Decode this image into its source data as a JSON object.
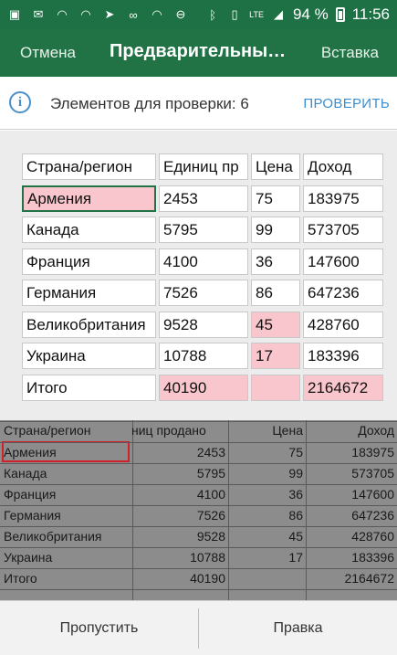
{
  "status": {
    "battery": "94 %",
    "time": "11:56",
    "signal": "LTE"
  },
  "appbar": {
    "cancel": "Отмена",
    "title": "Предварительный...",
    "insert": "Вставка"
  },
  "info": {
    "text": "Элементов для проверки: 6",
    "check": "ПРОВЕРИТЬ"
  },
  "table": {
    "headers": [
      "Страна/регион",
      "Единиц пр",
      "Цена",
      "Доход"
    ],
    "rows": [
      [
        "Армения",
        "2453",
        "75",
        "183975"
      ],
      [
        "Канада",
        "5795",
        "99",
        "573705"
      ],
      [
        "Франция",
        "4100",
        "36",
        "147600"
      ],
      [
        "Германия",
        "7526",
        "86",
        "647236"
      ],
      [
        "Великобритания",
        "9528",
        "45",
        "428760"
      ],
      [
        "Украина",
        "10788",
        "17",
        "183396"
      ],
      [
        "Итого",
        "40190",
        "",
        "2164672"
      ]
    ]
  },
  "photo": {
    "headers": [
      "Страна/регион",
      "ниц продано",
      "Цена",
      "Доход"
    ],
    "rows": [
      [
        "Армения",
        "2453",
        "75",
        "183975"
      ],
      [
        "Канада",
        "5795",
        "99",
        "573705"
      ],
      [
        "Франция",
        "4100",
        "36",
        "147600"
      ],
      [
        "Германия",
        "7526",
        "86",
        "647236"
      ],
      [
        "Великобритания",
        "9528",
        "45",
        "428760"
      ],
      [
        "Украина",
        "10788",
        "17",
        "183396"
      ],
      [
        "Итого",
        "40190",
        "",
        "2164672"
      ]
    ]
  },
  "bottom": {
    "skip": "Пропустить",
    "edit": "Правка"
  },
  "colors": {
    "accent": "#217346",
    "flag": "#f8c6cc",
    "link": "#3a8fd0"
  }
}
